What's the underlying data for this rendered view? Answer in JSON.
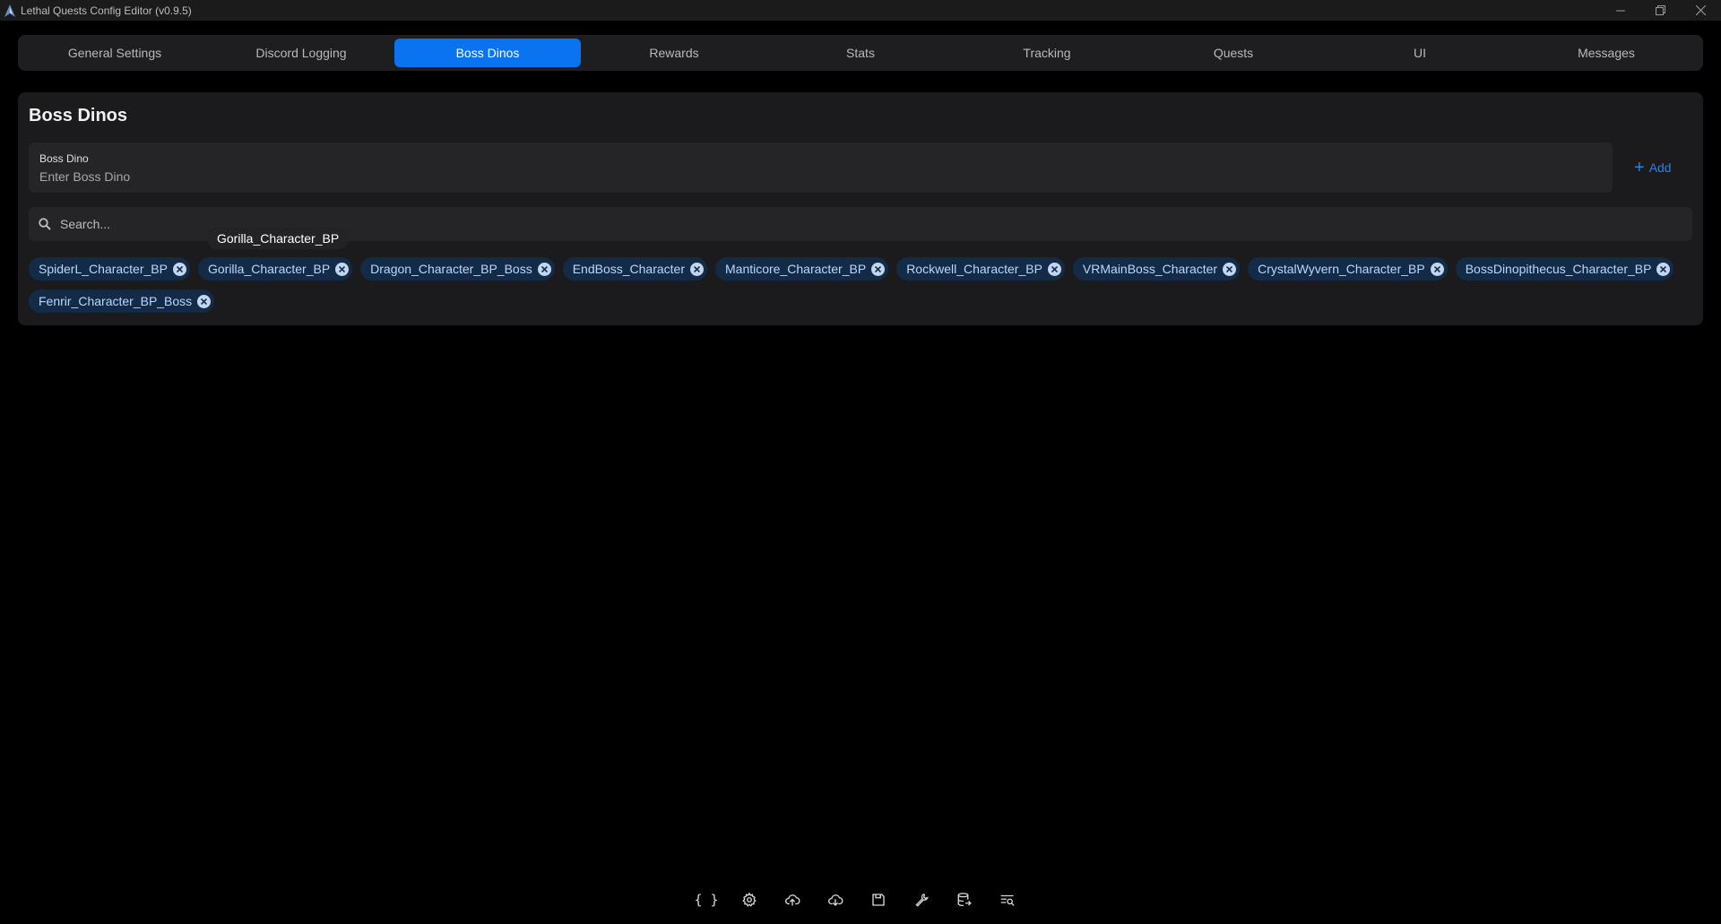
{
  "window": {
    "title": "Lethal Quests Config Editor (v0.9.5)"
  },
  "tabs": [
    {
      "label": "General Settings",
      "active": false
    },
    {
      "label": "Discord Logging",
      "active": false
    },
    {
      "label": "Boss Dinos",
      "active": true
    },
    {
      "label": "Rewards",
      "active": false
    },
    {
      "label": "Stats",
      "active": false
    },
    {
      "label": "Tracking",
      "active": false
    },
    {
      "label": "Quests",
      "active": false
    },
    {
      "label": "UI",
      "active": false
    },
    {
      "label": "Messages",
      "active": false
    }
  ],
  "panel": {
    "title": "Boss Dinos",
    "field_label": "Boss Dino",
    "field_placeholder": "Enter Boss Dino",
    "add_label": "Add",
    "search_placeholder": "Search...",
    "tooltip": "Gorilla_Character_BP"
  },
  "boss_dinos": [
    "SpiderL_Character_BP",
    "Gorilla_Character_BP",
    "Dragon_Character_BP_Boss",
    "EndBoss_Character",
    "Manticore_Character_BP",
    "Rockwell_Character_BP",
    "VRMainBoss_Character",
    "CrystalWyvern_Character_BP",
    "BossDinopithecus_Character_BP",
    "Fenrir_Character_BP_Boss"
  ],
  "toolbar": [
    {
      "icon": "braces-icon"
    },
    {
      "icon": "gear-icon"
    },
    {
      "icon": "cloud-upload-icon"
    },
    {
      "icon": "cloud-download-icon"
    },
    {
      "icon": "save-icon"
    },
    {
      "icon": "wrench-icon"
    },
    {
      "icon": "database-export-icon"
    },
    {
      "icon": "search-list-icon"
    }
  ],
  "colors": {
    "accent": "#0a74f0",
    "chip_bg": "#142b47",
    "chip_text": "#b8d7ff"
  }
}
